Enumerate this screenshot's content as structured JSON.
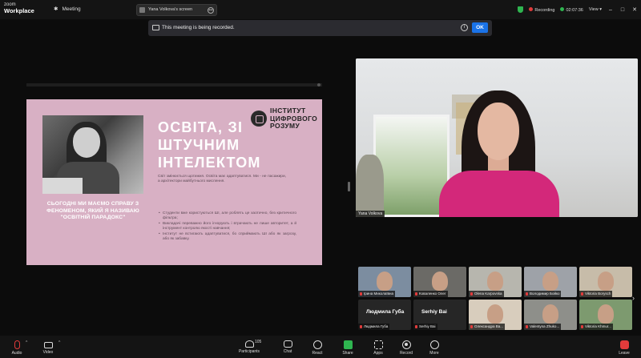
{
  "titlebar": {
    "logo_line1": "zoom",
    "logo_line2": "Workplace",
    "meeting_label": "Meeting",
    "screen_label": "Yana Volkova's screen",
    "recording_label": "Recording",
    "timer": "02:07:36",
    "view_label": "View"
  },
  "banner": {
    "message": "This meeting is being recorded.",
    "ok_label": "OK"
  },
  "slide": {
    "title_lines": [
      "ОСВІТА, ЗІ",
      "ШТУЧНИМ",
      "ІНТЕЛЕКТОМ"
    ],
    "institute": [
      "ІНСТИТУТ",
      "ЦИФРОВОГО",
      "РОЗУМУ"
    ],
    "quote": "СЬОГОДНІ МИ МАЄМО СПРАВУ З ФЕНОМЕНОМ, ЯКИЙ Я НАЗИВАЮ \"ОСВІТНІЙ ПАРАДОКС\"",
    "paragraph": "Світ змінюється щотижня. Освіта має адаптуватися. Ми - не пасажири, а архітектори майбутнього мислення.",
    "bullets": [
      "Студенти вже користуються ШІ, але роблять це хаотично, без критичного фільтра;",
      "Викладачі переважно його ігнорують і втрачають не лише авторитет, а й інструмент контролю якості навчання;",
      "Інститут не встигають адаптуватися, бо сприймають ШІ або як загрозу, або як забавку."
    ]
  },
  "speaker": {
    "name": "Yana Volkova"
  },
  "gallery": {
    "tiles": [
      {
        "label": "Ірина Миколаївна",
        "type": "video",
        "color": "#7c8da0"
      },
      {
        "label": "Коваленко Олег",
        "type": "video",
        "color": "#6b6a66"
      },
      {
        "label": "Olena Karpovska",
        "type": "video",
        "color": "#b7b6ae"
      },
      {
        "label": "Володимир Бойко",
        "type": "video",
        "color": "#9ea2a8"
      },
      {
        "label": "Viktoria Borysch",
        "type": "video",
        "color": "#c7bca9"
      },
      {
        "label": "Людмила Губа",
        "type": "text",
        "big": "Людмила Губа"
      },
      {
        "label": "Serhiy Bai",
        "type": "text",
        "big": "Serhiy Bai"
      },
      {
        "label": "Олександра Ва...",
        "type": "video",
        "color": "#d8cdbd"
      },
      {
        "label": "Valentyna Zhuko...",
        "type": "video",
        "color": "#8e8f8a"
      },
      {
        "label": "Viktoria Khmur...",
        "type": "video",
        "color": "#7d9a6f"
      }
    ]
  },
  "toolbar": {
    "audio": "Audio",
    "video": "Video",
    "participants": "Participants",
    "participant_count": "105",
    "chat": "Chat",
    "react": "React",
    "share": "Share",
    "apps": "Apps",
    "record": "Record",
    "more": "More",
    "leave": "Leave"
  },
  "colors": {
    "slide_bg": "#d8b0c4",
    "accent_blue": "#1a73e8",
    "recording_red": "#e23b3b",
    "share_green": "#2fb550",
    "speaker_jacket": "#d3287a"
  }
}
